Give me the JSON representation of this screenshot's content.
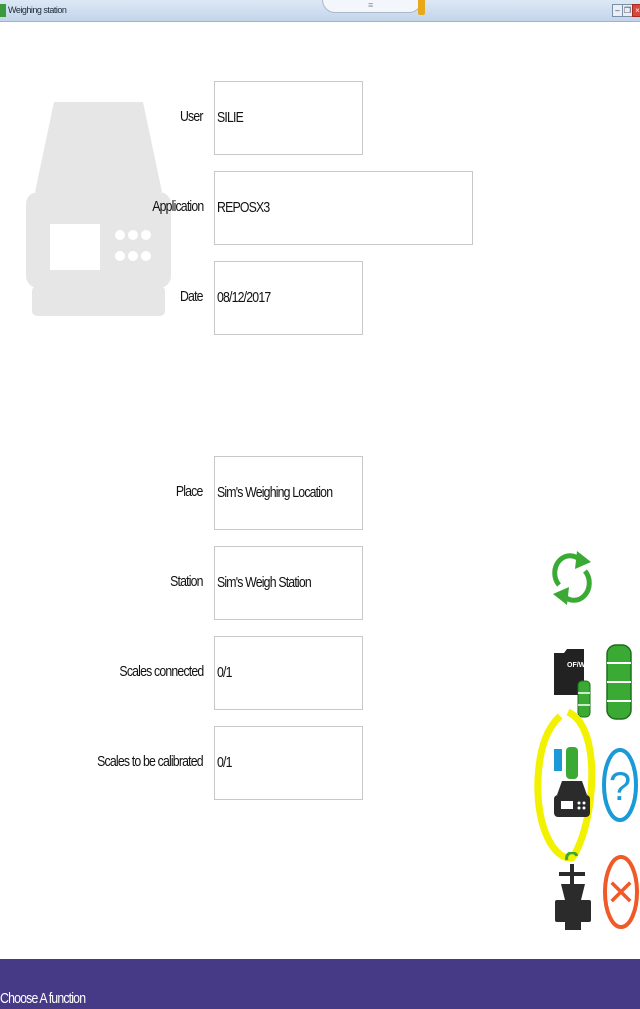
{
  "window": {
    "title": "Weighing station",
    "tab_handle_glyph": "≡",
    "minimize_glyph": "–",
    "restore_glyph": "❐",
    "close_glyph": "×"
  },
  "fields": {
    "user": {
      "label": "User",
      "value": "SILIE"
    },
    "application": {
      "label": "Application",
      "value": "REPOSX3"
    },
    "date": {
      "label": "Date",
      "value": "08/12/2017"
    },
    "place": {
      "label": "Place",
      "value": "Sim's Weighing Location"
    },
    "station": {
      "label": "Station",
      "value": "Sim's Weigh Station"
    },
    "scales_connected": {
      "label": "Scales connected",
      "value": "0/1"
    },
    "scales_to_calibrate": {
      "label": "Scales to be calibrated",
      "value": "0/1"
    }
  },
  "actions": {
    "refresh": "refresh-icon",
    "work_order": {
      "icon": "work-order-icon",
      "badge": "OF/WO"
    },
    "containers": "drums-icon",
    "weigh_scale": "scale-weighing-icon",
    "help": {
      "icon": "help-icon",
      "glyph": "?"
    },
    "valve": "valve-icon",
    "cancel": {
      "icon": "cancel-icon",
      "glyph": "✕"
    }
  },
  "colors": {
    "status_bar": "#463a86",
    "accent_green": "#3aaa35",
    "help_blue": "#1a9ad6",
    "cancel_orange": "#f05a28",
    "highlight_yellow": "#f2f200"
  },
  "status": {
    "text": "Choose A function"
  }
}
